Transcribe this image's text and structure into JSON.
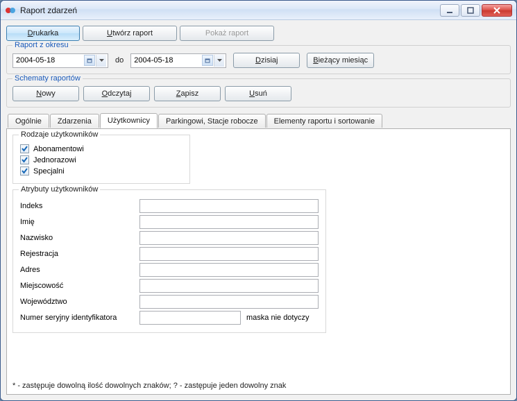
{
  "window": {
    "title": "Raport zdarzeń"
  },
  "topbar": {
    "print": "Drukarka",
    "create": "Utwórz raport",
    "show": "Pokaż raport"
  },
  "period": {
    "legend": "Raport z okresu",
    "from": "2004-05-18",
    "to_label": "do",
    "to": "2004-05-18",
    "today": "Dzisiaj",
    "current_month": "Bieżący miesiąc"
  },
  "schemas": {
    "legend": "Schematy raportów",
    "new": "Nowy",
    "read": "Odczytaj",
    "save": "Zapisz",
    "delete": "Usuń"
  },
  "tabs": {
    "t0": "Ogólnie",
    "t1": "Zdarzenia",
    "t2": "Użytkownicy",
    "t3": "Parkingowi, Stacje robocze",
    "t4": "Elementy raportu i sortowanie"
  },
  "usertypes": {
    "legend": "Rodzaje użytkowników",
    "c0": "Abonamentowi",
    "c1": "Jednorazowi",
    "c2": "Specjalni"
  },
  "attrs": {
    "legend": "Atrybuty użytkowników",
    "f0": "Indeks",
    "f1": "Imię",
    "f2": "Nazwisko",
    "f3": "Rejestracja",
    "f4": "Adres",
    "f5": "Miejscowość",
    "f6": "Województwo",
    "f7": "Numer seryjny identyfikatora",
    "mask_note": "maska nie dotyczy"
  },
  "footnote": "* - zastępuje dowolną ilość dowolnych znaków; ? - zastępuje jeden dowolny znak"
}
